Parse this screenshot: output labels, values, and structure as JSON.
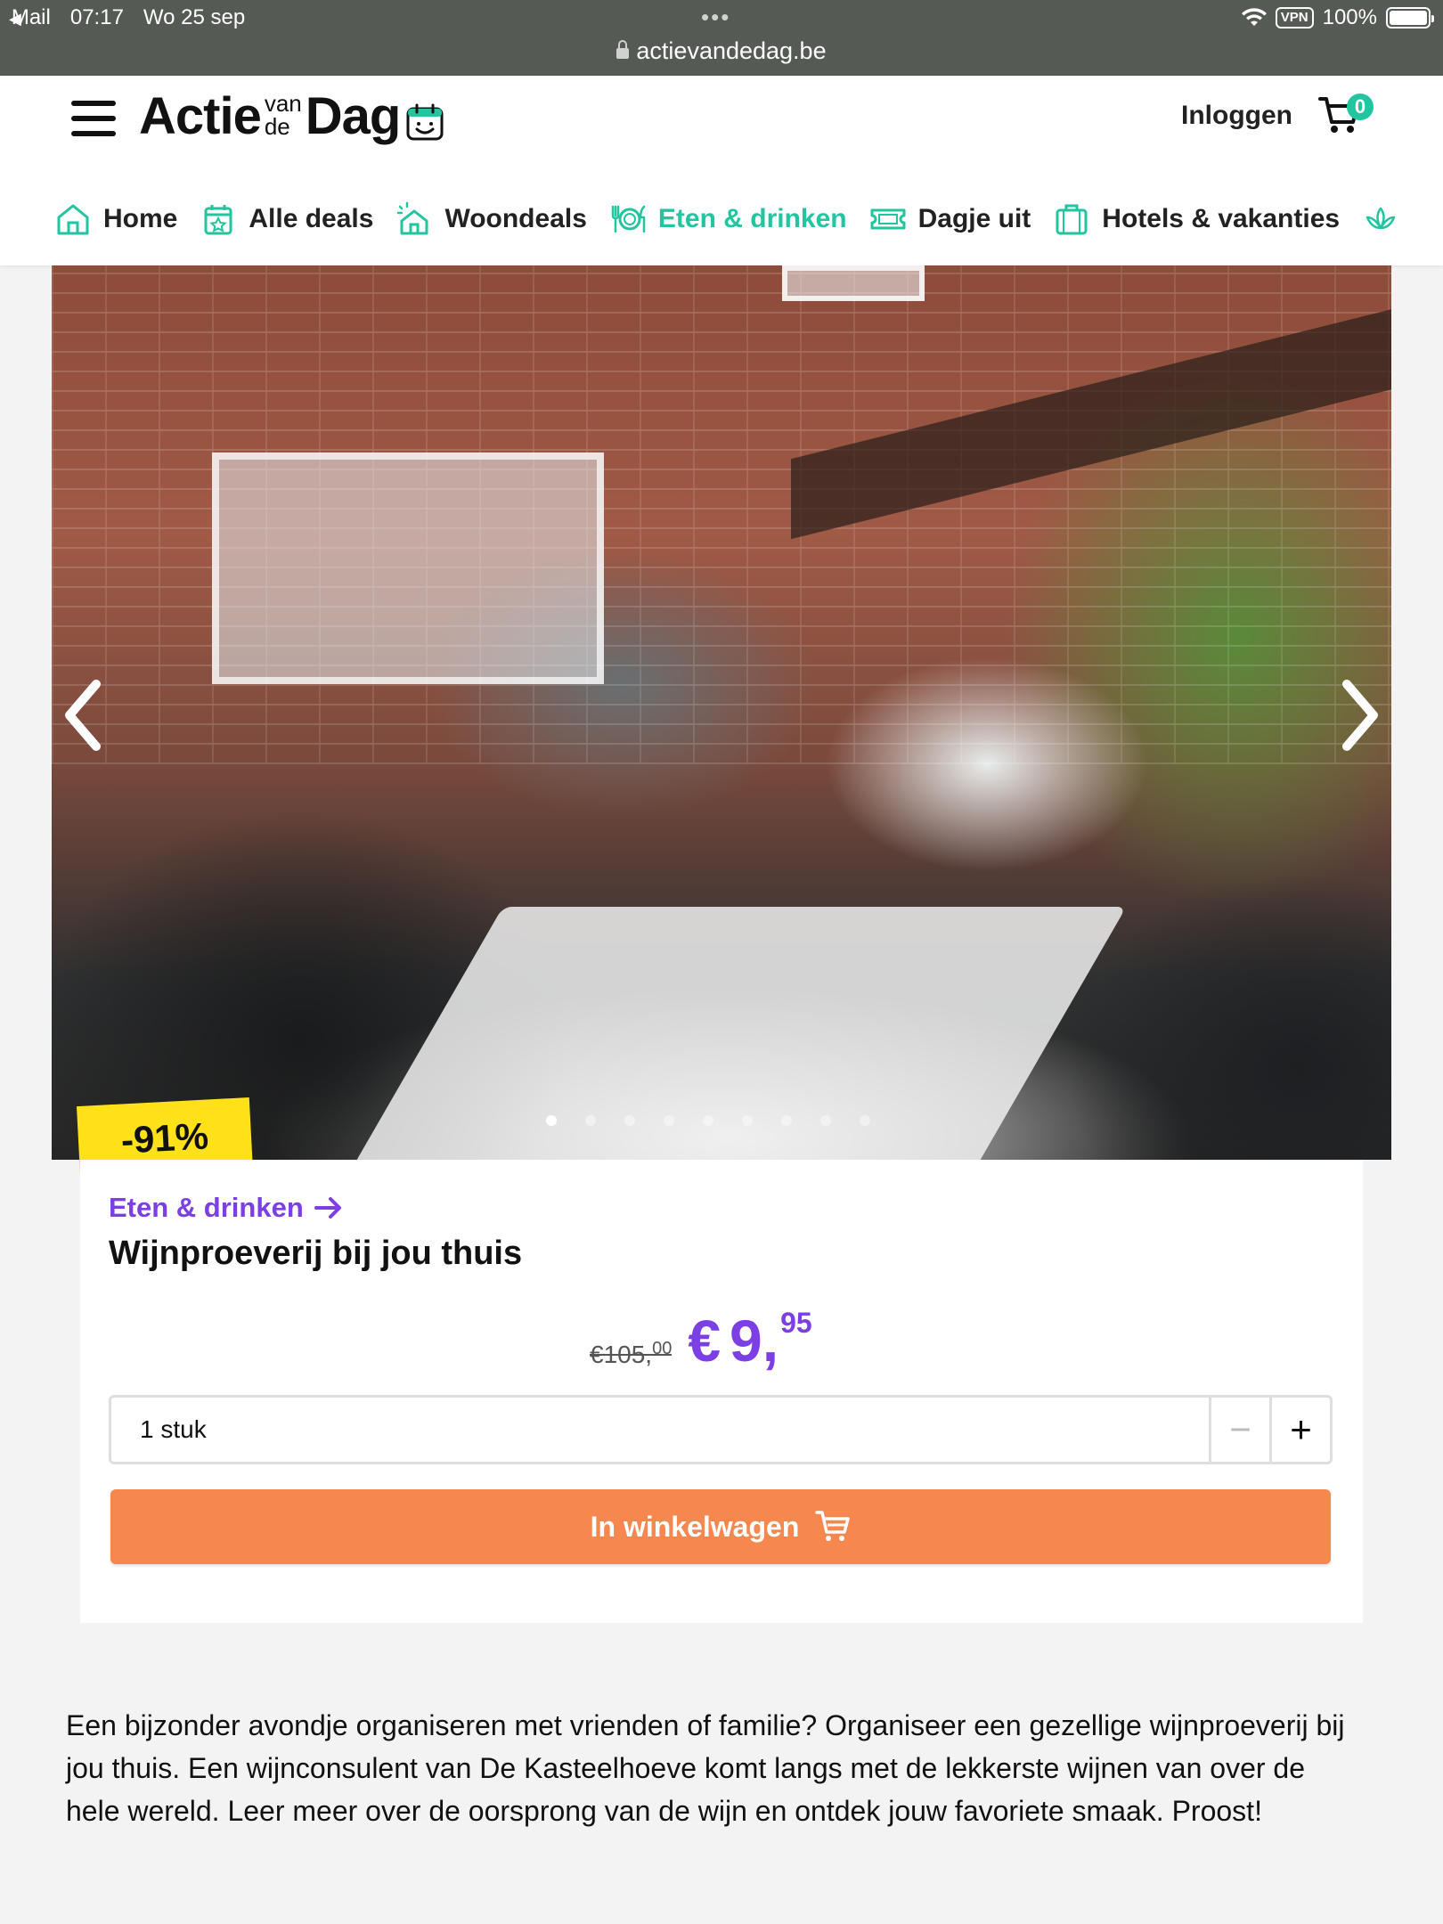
{
  "status_bar": {
    "back_app": "Mail",
    "time": "07:17",
    "date": "Wo 25 sep",
    "vpn": "VPN",
    "battery": "100%",
    "url": "actievandedag.be"
  },
  "header": {
    "logo": {
      "word1": "Actie",
      "small_top": "van",
      "small_bottom": "de",
      "word2": "Dag"
    },
    "login": "Inloggen",
    "cart_count": "0",
    "accent_color": "#21c5a0"
  },
  "nav": {
    "items": [
      {
        "label": "Home",
        "icon": "home-icon"
      },
      {
        "label": "Alle deals",
        "icon": "calendar-star-icon"
      },
      {
        "label": "Woondeals",
        "icon": "house-sparkle-icon"
      },
      {
        "label": "Eten & drinken",
        "icon": "cutlery-plate-icon",
        "active": true
      },
      {
        "label": "Dagje uit",
        "icon": "ticket-icon"
      },
      {
        "label": "Hotels & vakanties",
        "icon": "suitcase-icon"
      },
      {
        "label": "",
        "icon": "lotus-icon"
      }
    ]
  },
  "hero": {
    "discount": "-91%",
    "slide_count": 9,
    "active_slide": 0
  },
  "product": {
    "category": "Eten & drinken",
    "title": "Wijnproeverij bij jou thuis",
    "old_price_int": "€105,",
    "old_price_dec": "00",
    "price_currency": "€",
    "price_int": "9,",
    "price_dec": "95",
    "quantity": "1 stuk",
    "minus": "−",
    "plus": "+",
    "add_to_cart": "In winkelwagen",
    "accent_purple": "#7b3fe4",
    "cta_color": "#f5874f"
  },
  "description": "Een bijzonder avondje organiseren met vrienden of familie? Organiseer een gezellige wijnproeverij bij jou thuis. Een wijnconsulent van De Kasteelhoeve komt langs met de lekkerste wijnen van over de hele wereld. Leer meer over de oorsprong van de wijn en ontdek jouw favoriete smaak. Proost!"
}
